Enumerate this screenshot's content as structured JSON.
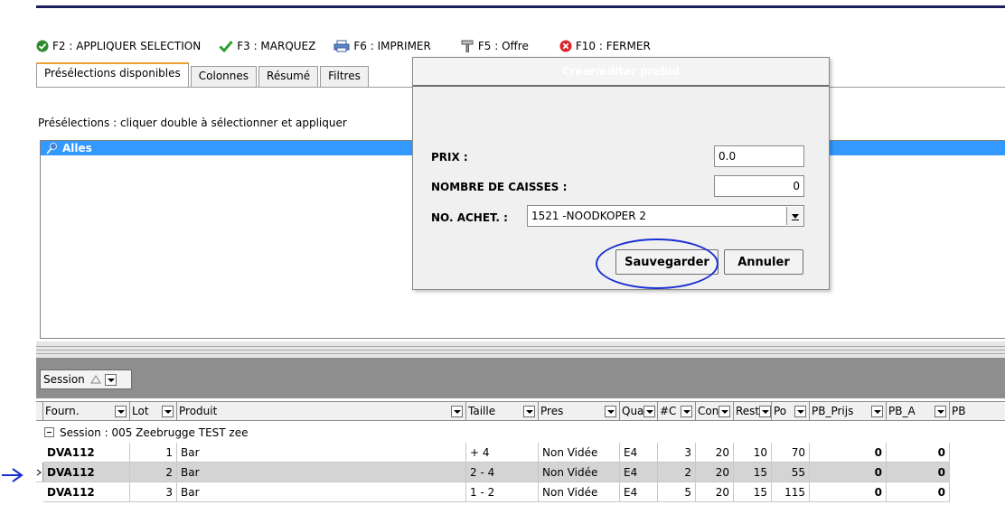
{
  "toolbar": {
    "apply": "F2 : APPLIQUER SELECTION",
    "mark": "F3 : MARQUEZ",
    "print": "F6 : IMPRIMER",
    "offer": "F5 : Offre",
    "close": "F10 : FERMER"
  },
  "tabs": [
    "Présélections disponibles",
    "Colonnes",
    "Résumé",
    "Filtres"
  ],
  "preselections": {
    "label": "Présélections : cliquer double à sélectionner et appliquer",
    "items": [
      "Alles"
    ]
  },
  "grouping": {
    "button_label": "Session"
  },
  "grid": {
    "headers": [
      "Fourn.",
      "Lot",
      "Produit",
      "Taille",
      "Pres",
      "Qua",
      "#C",
      "Con",
      "Rest",
      "Po",
      "PB_Prijs",
      "PB_A",
      "PB"
    ],
    "group_label": "Session : 005 Zeebrugge TEST zee",
    "rows": [
      {
        "fourn": "DVA112",
        "lot": "1",
        "produit": "Bar",
        "taille": "+ 4",
        "pres": "Non Vidée",
        "qua": "E4",
        "c": "3",
        "con": "20",
        "rest": "10",
        "po": "70",
        "pb_prijs": "0",
        "pb_a": "0"
      },
      {
        "fourn": "DVA112",
        "lot": "2",
        "produit": "Bar",
        "taille": "2 - 4",
        "pres": "Non Vidée",
        "qua": "E4",
        "c": "2",
        "con": "20",
        "rest": "15",
        "po": "55",
        "pb_prijs": "0",
        "pb_a": "0"
      },
      {
        "fourn": "DVA112",
        "lot": "3",
        "produit": "Bar",
        "taille": "1 - 2",
        "pres": "Non Vidée",
        "qua": "E4",
        "c": "5",
        "con": "20",
        "rest": "15",
        "po": "115",
        "pb_prijs": "0",
        "pb_a": "0"
      }
    ]
  },
  "dialog": {
    "title": "Créer/éditer prebid",
    "price_label": "PRIX :",
    "price_value": "0.0",
    "cases_label": "NOMBRE DE CAISSES :",
    "cases_value": "0",
    "buyer_label": "NO. ACHET. :",
    "buyer_value": "1521 -NOODKOPER 2",
    "save": "Sauvegarder",
    "cancel": "Annuler"
  },
  "colors": {
    "selection": "#3399ff",
    "annotation": "#1a2fd0",
    "titlebar": "#1b1f5a"
  }
}
